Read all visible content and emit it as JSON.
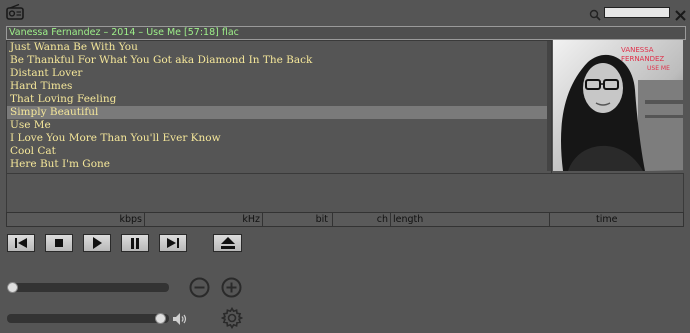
{
  "now_playing": "Vanessa Fernandez – 2014 – Use Me [57:18] flac",
  "search": {
    "value": ""
  },
  "playlist": {
    "tracks": [
      "Just Wanna Be With You",
      "Be Thankful For What You Got aka Diamond In The Back",
      "Distant Lover",
      "Hard Times",
      "That Loving Feeling",
      "Simply Beautiful",
      "Use Me",
      "I Love You More Than You'll Ever Know",
      "Cool Cat",
      "Here But I'm Gone"
    ],
    "selected_index": 5
  },
  "album_art": {
    "artist_text": "VANESSA FERNANDEZ",
    "title_text": "USE ME"
  },
  "status": {
    "kbps_label": "kbps",
    "khz_label": "kHz",
    "bit_label": "bit",
    "ch_label": "ch",
    "length_label": "length",
    "time_label": "time"
  },
  "sliders": {
    "position_fraction": 0.0,
    "volume_fraction": 0.98
  },
  "icons": {
    "radio": "radio-icon",
    "search": "search-icon",
    "close": "close-icon",
    "previous": "skip-previous-icon",
    "stop": "stop-icon",
    "play": "play-icon",
    "pause": "pause-icon",
    "next": "skip-next-icon",
    "eject": "eject-icon",
    "zoom_out": "minus-circle-icon",
    "zoom_in": "plus-circle-icon",
    "volume": "speaker-icon",
    "settings": "gear-icon"
  },
  "colors": {
    "background": "#555555",
    "track_text": "#f5e79a",
    "now_playing_text": "#9ef08a",
    "selected_row": "#7a7a7a",
    "album_accent": "#e0304a"
  }
}
